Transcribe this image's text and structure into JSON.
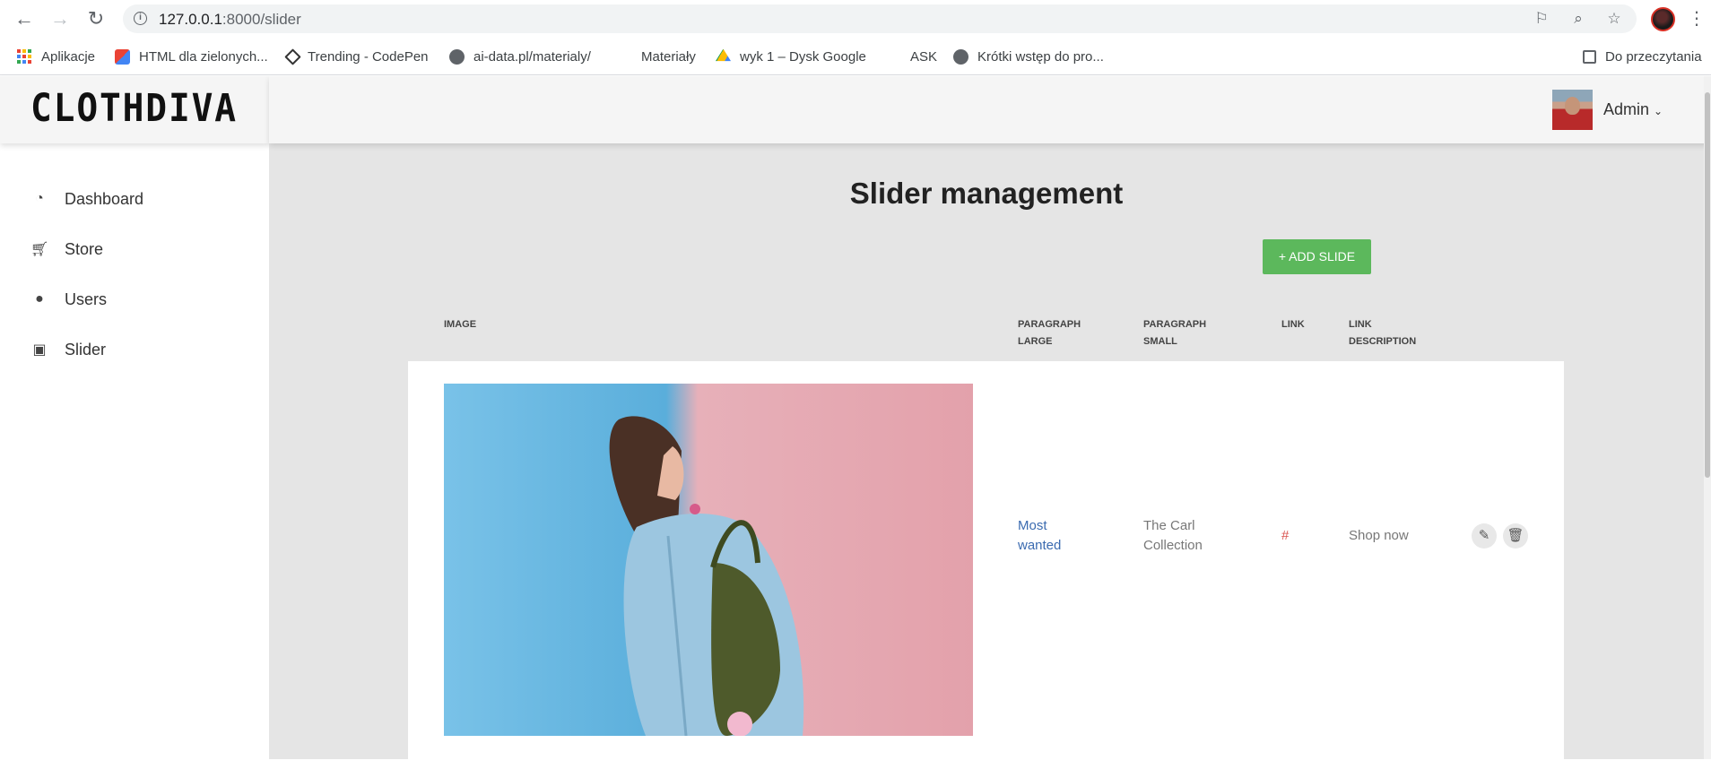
{
  "browser": {
    "url_host": "127.0.0.1",
    "url_path": ":8000/slider",
    "bookmarks": [
      {
        "label": "Aplikacje"
      },
      {
        "label": "HTML dla zielonych..."
      },
      {
        "label": "Trending - CodePen"
      },
      {
        "label": "ai-data.pl/materialy/"
      },
      {
        "label": "Materiały"
      },
      {
        "label": "wyk 1 – Dysk Google"
      },
      {
        "label": "ASK"
      },
      {
        "label": "Krótki wstęp do pro..."
      },
      {
        "label": "Do przeczytania"
      }
    ]
  },
  "app": {
    "logo": "CLOTHDIVA",
    "user": "Admin",
    "sidebar": [
      {
        "label": "Dashboard",
        "icon": "dashboard-icon"
      },
      {
        "label": "Store",
        "icon": "cart-icon"
      },
      {
        "label": "Users",
        "icon": "user-icon"
      },
      {
        "label": "Slider",
        "icon": "image-icon"
      }
    ]
  },
  "main": {
    "title": "Slider management",
    "add_label": "+ ADD SLIDE",
    "columns": {
      "image": "IMAGE",
      "par_large": [
        "PARAGRAPH",
        "LARGE"
      ],
      "par_small": [
        "PARAGRAPH",
        "SMALL"
      ],
      "link": "LINK",
      "link_desc": [
        "LINK",
        "DESCRIPTION"
      ]
    },
    "rows": [
      {
        "paragraph_large": [
          "Most",
          "wanted"
        ],
        "paragraph_small": [
          "The Carl",
          "Collection"
        ],
        "link": "#",
        "link_description": "Shop now"
      }
    ]
  },
  "colors": {
    "accent_green": "#5cb85c",
    "link_blue": "#3b6bb0",
    "link_red": "#d9534f"
  }
}
